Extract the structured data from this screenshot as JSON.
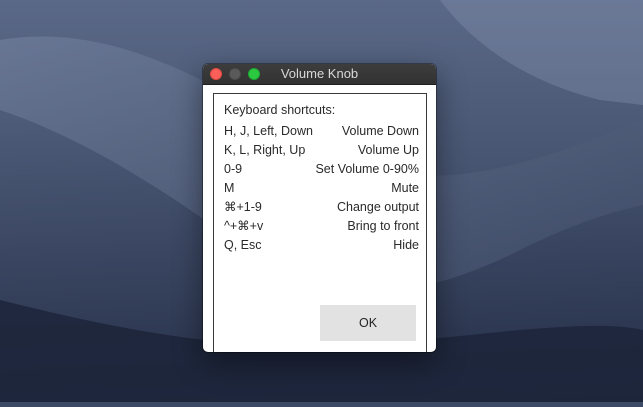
{
  "window": {
    "title": "Volume Knob"
  },
  "heading": "Keyboard shortcuts:",
  "shortcuts": [
    {
      "keys": "H, J, Left, Down",
      "action": "Volume Down"
    },
    {
      "keys": "K, L, Right, Up",
      "action": "Volume Up"
    },
    {
      "keys": "0-9",
      "action": "Set Volume 0-90%"
    },
    {
      "keys": "M",
      "action": "Mute"
    },
    {
      "keys": "⌘+1-9",
      "action": "Change output"
    },
    {
      "keys": "^+⌘+v",
      "action": "Bring to front"
    },
    {
      "keys": "Q, Esc",
      "action": "Hide"
    }
  ],
  "ok_label": "OK"
}
